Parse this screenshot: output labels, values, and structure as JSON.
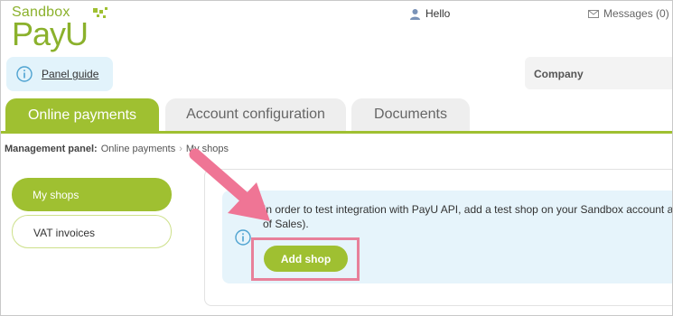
{
  "header": {
    "logo_top": "Sandbox",
    "logo_main": "PayU",
    "user_greeting": "Hello",
    "messages_label": "Messages (0)"
  },
  "panel_guide": {
    "label": "Panel guide"
  },
  "company": {
    "label": "Company"
  },
  "tabs": [
    {
      "label": "Online payments",
      "active": true
    },
    {
      "label": "Account configuration",
      "active": false
    },
    {
      "label": "Documents",
      "active": false
    }
  ],
  "breadcrumb": {
    "title": "Management panel:",
    "items": [
      "Online payments",
      "My shops"
    ],
    "separator": "›"
  },
  "sidebar": {
    "items": [
      {
        "label": "My shops",
        "active": true
      },
      {
        "label": "VAT invoices",
        "active": false
      }
    ]
  },
  "info_box": {
    "line1": "In order to test integration with PayU API, add a test shop on your Sandbox account a",
    "line2": "of Sales).",
    "button_label": "Add shop"
  },
  "colors": {
    "brand_green": "#9fc031",
    "logo_green": "#8bb12c",
    "info_bg": "#e6f4fb",
    "highlight": "#e8809a",
    "arrow": "#ef7595"
  }
}
